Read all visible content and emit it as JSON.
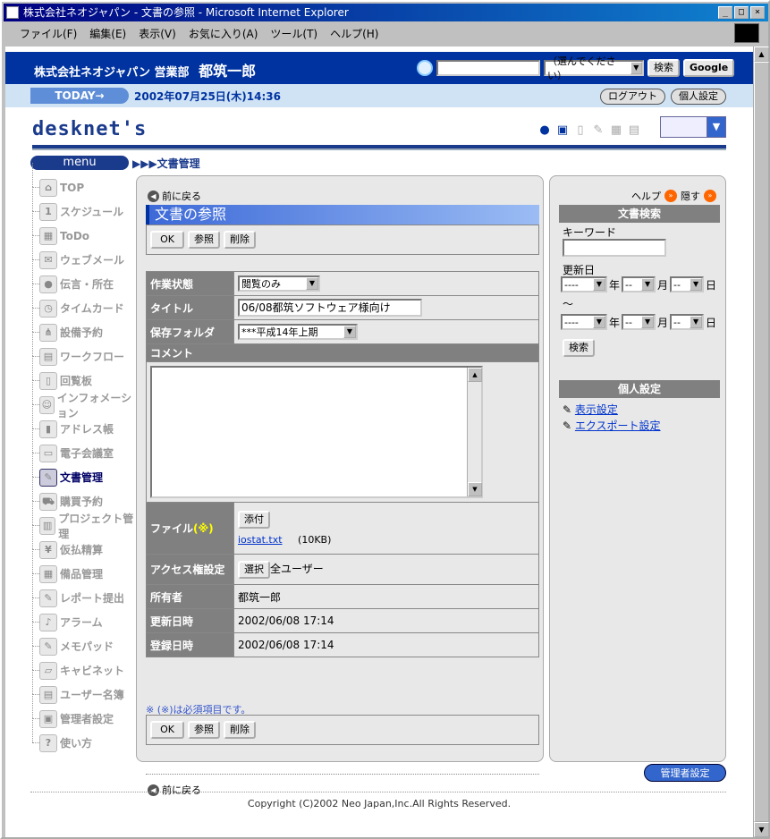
{
  "window": {
    "title": "株式会社ネオジャパン - 文書の参照 - Microsoft Internet Explorer",
    "buttons": {
      "min": "_",
      "max": "□",
      "close": "×"
    }
  },
  "menubar": [
    "ファイル(F)",
    "編集(E)",
    "表示(V)",
    "お気に入り(A)",
    "ツール(T)",
    "ヘルプ(H)"
  ],
  "header": {
    "company": "株式会社ネオジャパン 営業部",
    "user": "都筑一郎",
    "search_value": "",
    "search_select": "（選んでください）",
    "search_button": "検索",
    "google_button": "Google"
  },
  "today": {
    "label": "TODAY→",
    "datetime": "2002年07月25日(木)14:36",
    "logout": "ログアウト",
    "personal": "個人設定"
  },
  "brand": "desknet's",
  "nav": {
    "menu": "menu",
    "breadcrumb": "▶▶▶文書管理"
  },
  "sidebar": [
    {
      "label": "TOP",
      "icon": "home-icon",
      "glyph": "⌂"
    },
    {
      "label": "スケジュール",
      "icon": "schedule-icon",
      "glyph": "1"
    },
    {
      "label": "ToDo",
      "icon": "todo-icon",
      "glyph": "▦"
    },
    {
      "label": "ウェブメール",
      "icon": "webmail-icon",
      "glyph": "✉"
    },
    {
      "label": "伝言・所在",
      "icon": "message-icon",
      "glyph": "●"
    },
    {
      "label": "タイムカード",
      "icon": "timecard-icon",
      "glyph": "◷"
    },
    {
      "label": "設備予約",
      "icon": "facility-icon",
      "glyph": "⋔"
    },
    {
      "label": "ワークフロー",
      "icon": "workflow-icon",
      "glyph": "▤"
    },
    {
      "label": "回覧板",
      "icon": "circular-icon",
      "glyph": "▯"
    },
    {
      "label": "インフォメーション",
      "icon": "information-icon",
      "glyph": "☺"
    },
    {
      "label": "アドレス帳",
      "icon": "address-book-icon",
      "glyph": "▮"
    },
    {
      "label": "電子会議室",
      "icon": "meeting-room-icon",
      "glyph": "▭"
    },
    {
      "label": "文書管理",
      "icon": "document-icon",
      "glyph": "✎",
      "active": true
    },
    {
      "label": "購買予約",
      "icon": "purchase-icon",
      "glyph": "⛟"
    },
    {
      "label": "プロジェクト管理",
      "icon": "project-icon",
      "glyph": "▥"
    },
    {
      "label": "仮払精算",
      "icon": "expense-icon",
      "glyph": "¥"
    },
    {
      "label": "備品管理",
      "icon": "equipment-icon",
      "glyph": "▦"
    },
    {
      "label": "レポート提出",
      "icon": "report-icon",
      "glyph": "✎"
    },
    {
      "label": "アラーム",
      "icon": "alarm-icon",
      "glyph": "♪"
    },
    {
      "label": "メモパッド",
      "icon": "memo-icon",
      "glyph": "✎"
    },
    {
      "label": "キャビネット",
      "icon": "cabinet-icon",
      "glyph": "▱"
    },
    {
      "label": "ユーザー名簿",
      "icon": "user-list-icon",
      "glyph": "▤"
    },
    {
      "label": "管理者設定",
      "icon": "admin-settings-icon",
      "glyph": "▣"
    },
    {
      "label": "使い方",
      "icon": "help-icon",
      "glyph": "?"
    }
  ],
  "main": {
    "back": "前に戻る",
    "title": "文書の参照",
    "buttons": {
      "ok": "OK",
      "ref": "参照",
      "del": "削除"
    },
    "fields": {
      "status_label": "作業状態",
      "status_value": "閲覧のみ",
      "title_label": "タイトル",
      "title_value": "06/08都筑ソフトウェア様向け",
      "folder_label": "保存フォルダ",
      "folder_value": "***平成14年上期",
      "comment_label": "コメント",
      "comment_value": "",
      "file_label": "ファイル",
      "file_req": "(※)",
      "attach": "添付",
      "file_name": "iostat.txt",
      "file_size": "(10KB)",
      "access_label": "アクセス権設定",
      "select": "選択",
      "access_value": "全ユーザー",
      "owner_label": "所有者",
      "owner_value": "都筑一郎",
      "updated_label": "更新日時",
      "updated_value": "2002/06/08 17:14",
      "created_label": "登録日時",
      "created_value": "2002/06/08 17:14"
    },
    "note": "※ (※)は必須項目です。"
  },
  "right": {
    "help": "ヘルプ",
    "hide": "隠す",
    "search_title": "文書検索",
    "keyword_label": "キーワード",
    "keyword_value": "",
    "date_label": "更新日",
    "date_empty": "----",
    "date_empty2": "--",
    "year": "年",
    "month": "月",
    "day": "日",
    "tilde": "～",
    "search_button": "検索",
    "personal_title": "個人設定",
    "display_settings": "表示設定",
    "export_settings": "エクスポート設定"
  },
  "admin_button": "管理者設定",
  "footer": "Copyright (C)2002 Neo Japan,Inc.All Rights Reserved."
}
